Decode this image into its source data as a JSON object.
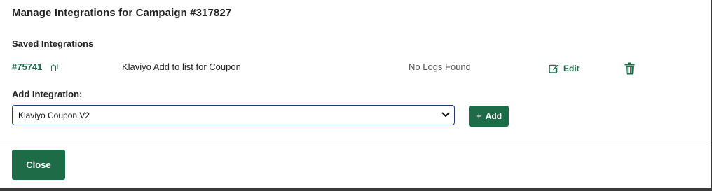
{
  "modal": {
    "title": "Manage Integrations for Campaign #317827"
  },
  "saved": {
    "label": "Saved Integrations",
    "items": [
      {
        "id": "#75741",
        "name": "Klaviyo Add to list for Coupon",
        "logs": "No Logs Found",
        "edit_label": "Edit"
      }
    ]
  },
  "add": {
    "label": "Add Integration:",
    "selected": "Klaviyo Coupon V2",
    "button_label": "Add"
  },
  "footer": {
    "close_label": "Close"
  },
  "colors": {
    "accent": "#1e6b47",
    "select_border": "#1f3f73"
  },
  "icons": {
    "copy": "copy-icon",
    "edit": "pencil-square-icon",
    "delete": "trash-icon",
    "dropdown": "chevron-down-icon",
    "add": "plus-icon"
  }
}
